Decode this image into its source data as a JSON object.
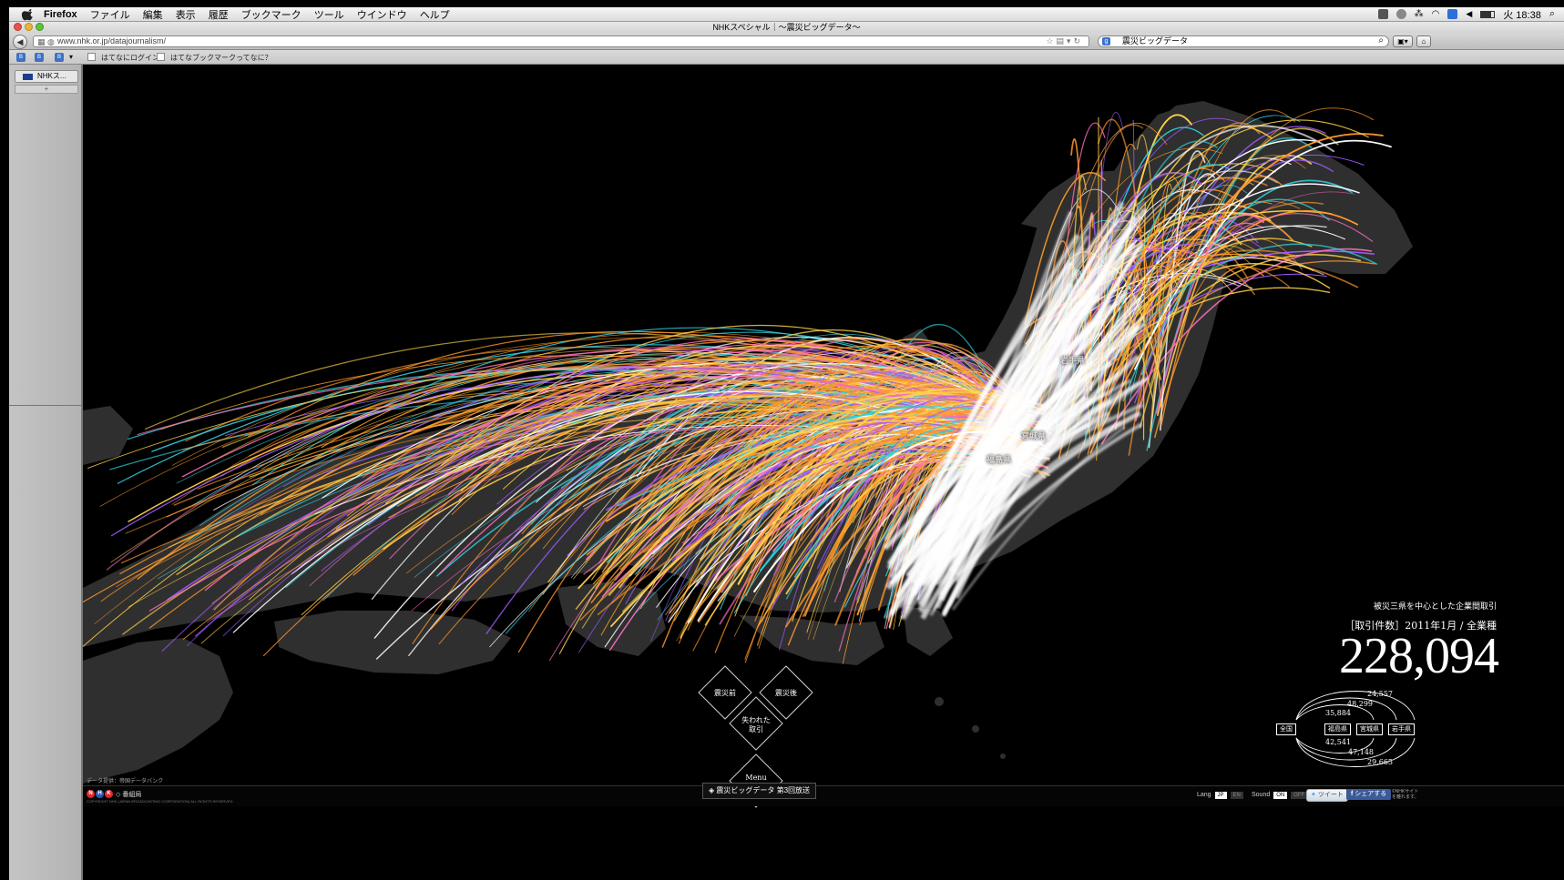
{
  "menubar": {
    "app": "Firefox",
    "menus": [
      "ファイル",
      "編集",
      "表示",
      "履歴",
      "ブックマーク",
      "ツール",
      "ウインドウ",
      "ヘルプ"
    ],
    "clock": "火 18:38"
  },
  "window": {
    "title": "NHKスペシャル｜〜震災ビッグデータ〜"
  },
  "navbar": {
    "url": "www.nhk.or.jp/datajournalism/",
    "search": "震災ビッグデータ"
  },
  "bookmarks": [
    "はてなにログイン",
    "はてなブックマークってなに？"
  ],
  "sidebar": {
    "tab_label": "NHKス...",
    "new_tab": "+"
  },
  "map": {
    "labels": {
      "iwate": "岩手県",
      "miyagi": "宮城県",
      "fukushima": "福島県"
    },
    "colors": {
      "land": "#2f2f2f",
      "orange": "#ff9a2a",
      "gold": "#ffd24a",
      "pink": "#ff6fc0",
      "purple": "#a05cff",
      "cyan": "#2fd0e0",
      "white": "#ffffff"
    }
  },
  "stats": {
    "title": "被災三県を中心とした企業間取引",
    "subtitle": "［取引件数］2011年1月 / 全業種",
    "total": "228,094",
    "nodes": {
      "national": "全国",
      "fukushima": "福島県",
      "miyagi": "宮城県",
      "iwate": "岩手県"
    },
    "flows": {
      "top_outer": "24,557",
      "top_middle": "48,299",
      "top_inner": "35,884",
      "bottom_inner": "42,541",
      "bottom_middle": "47,148",
      "bottom_outer": "29,665"
    }
  },
  "nav_menu": {
    "before": "震災前",
    "after": "震災後",
    "lost": "失われた\n取引",
    "menu": "Menu"
  },
  "footer": {
    "credit": "データ提供：帝国データバンク",
    "brand": "◇ 番組局",
    "copyright": "COPYRIGHT NHK (JAPAN BROADCASTING CORPORATION) ALL RIGHTS RESERVED",
    "broadcast": "◈ 震災ビッグデータ 第3回放送",
    "lang_label": "Lang",
    "lang_jp": "JP",
    "lang_en": "EN",
    "sound_label": "Sound",
    "sound_on": "ON",
    "sound_off": "OFF",
    "tweet": "ツイート",
    "share": "シェアする",
    "nhk_link": "©NHKサイト\nを離れます。"
  }
}
